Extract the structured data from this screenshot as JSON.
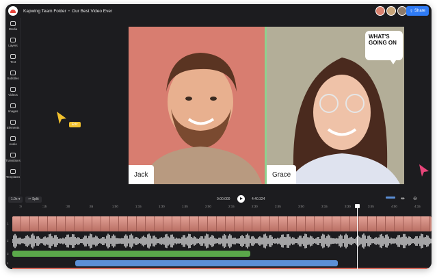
{
  "header": {
    "folder": "Kapwing Team Folder",
    "separator": "•",
    "project": "Our Best Video Ever",
    "share_label": "Share",
    "avatar_colors": [
      "#d9826f",
      "#c8a57a",
      "#8c7a6a"
    ]
  },
  "sidebar": {
    "items": [
      {
        "label": "Media",
        "icon": "media-icon"
      },
      {
        "label": "Layers",
        "icon": "layers-icon"
      },
      {
        "label": "Text",
        "icon": "text-icon"
      },
      {
        "label": "Subtitles",
        "icon": "subtitles-icon"
      },
      {
        "label": "Videos",
        "icon": "videos-icon"
      },
      {
        "label": "Images",
        "icon": "images-icon"
      },
      {
        "label": "Elements",
        "icon": "elements-icon"
      },
      {
        "label": "Audio",
        "icon": "audio-icon"
      },
      {
        "label": "Transitions",
        "icon": "transitions-icon"
      },
      {
        "label": "Templates",
        "icon": "templates-icon"
      }
    ]
  },
  "canvas": {
    "left_name": "Jack",
    "right_name": "Grace",
    "bubble_text": "WHAT'S GOING ON",
    "cursor_label": "Eric",
    "colors": {
      "left_bg": "#d87d70",
      "right_bg": "#b3ae98",
      "divider": "#8fd08f",
      "cursor_yellow": "#f2c12e",
      "cursor_pink": "#e8457a"
    }
  },
  "timeline": {
    "speed": "1.0x",
    "split_label": "Split",
    "current_time": "0:00.000",
    "total_time": "4:40.324",
    "ruler_ticks": [
      ":0",
      ":15",
      ":30",
      ":45",
      "1:00",
      "1:15",
      "1:30",
      "1:45",
      "2:00",
      "2:15",
      "2:30",
      "2:45",
      "3:00",
      "3:15",
      "3:30",
      "3:45",
      "4:00",
      "4:15"
    ],
    "track_numbers": [
      "1",
      "2",
      "3",
      "4"
    ],
    "colors": {
      "video_track": "#c98478",
      "audio_track": "#ffffff",
      "green_clip": "#5aa84a",
      "blue_clip": "#5b8fd6"
    }
  }
}
